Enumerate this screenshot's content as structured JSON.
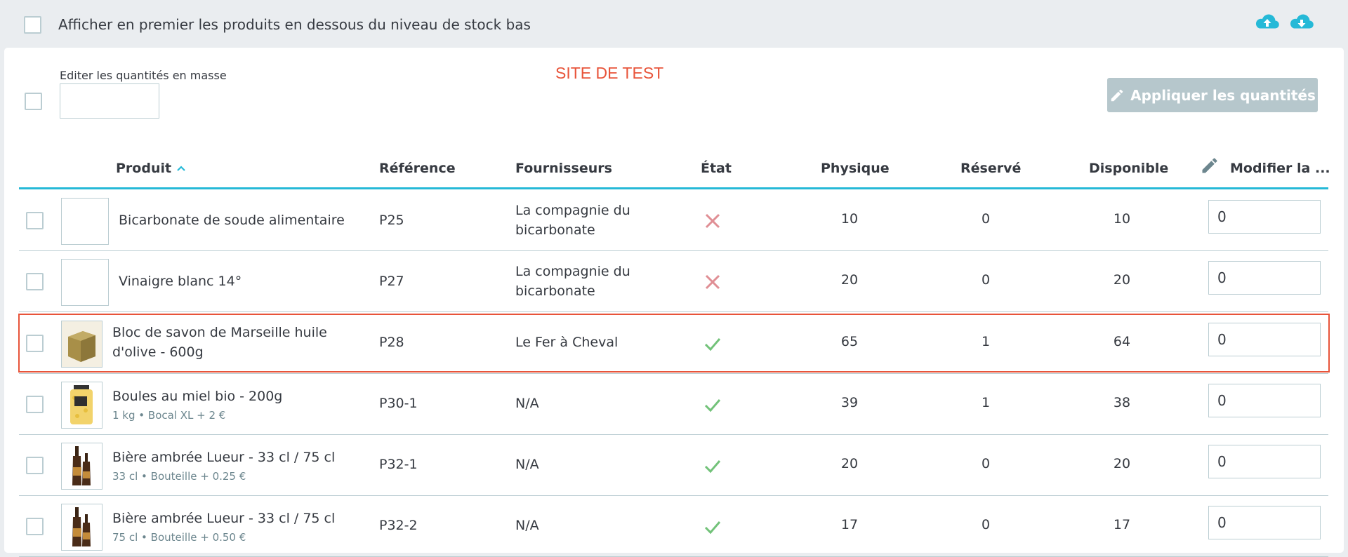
{
  "filter": {
    "label": "Afficher en premier les produits en dessous du niveau de stock bas"
  },
  "watermark": "SITE DE TEST",
  "bulk": {
    "label": "Editer les quantités en masse",
    "value": ""
  },
  "apply_button": {
    "label": "Appliquer les quantités"
  },
  "table": {
    "headers": {
      "product": "Produit",
      "reference": "Référence",
      "suppliers": "Fournisseurs",
      "state": "État",
      "physical": "Physique",
      "reserved": "Réservé",
      "available": "Disponible",
      "edit": "Modifier la ..."
    },
    "rows": [
      {
        "name": "Bicarbonate de soude alimentaire",
        "attr": "",
        "image": "",
        "reference": "P25",
        "supplier": "La compagnie du bicarbonate",
        "state": "inactive",
        "physical": "10",
        "reserved": "0",
        "available": "10",
        "qty": "0"
      },
      {
        "name": "Vinaigre blanc 14°",
        "attr": "",
        "image": "",
        "reference": "P27",
        "supplier": "La compagnie du bicarbonate",
        "state": "inactive",
        "physical": "20",
        "reserved": "0",
        "available": "20",
        "qty": "0"
      },
      {
        "name": "Bloc de savon de Marseille huile d'olive - 600g",
        "attr": "",
        "image": "soap",
        "reference": "P28",
        "supplier": "Le Fer à Cheval",
        "state": "active",
        "physical": "65",
        "reserved": "1",
        "available": "64",
        "qty": "0"
      },
      {
        "name": "Boules au miel bio - 200g",
        "attr": "1 kg • Bocal XL + 2 €",
        "image": "honey",
        "reference": "P30-1",
        "supplier": "N/A",
        "state": "active",
        "physical": "39",
        "reserved": "1",
        "available": "38",
        "qty": "0"
      },
      {
        "name": "Bière ambrée Lueur - 33 cl / 75 cl",
        "attr": "33 cl • Bouteille + 0.25 €",
        "image": "beer",
        "reference": "P32-1",
        "supplier": "N/A",
        "state": "active",
        "physical": "20",
        "reserved": "0",
        "available": "20",
        "qty": "0"
      },
      {
        "name": "Bière ambrée Lueur - 33 cl / 75 cl",
        "attr": "75 cl • Bouteille + 0.50 €",
        "image": "beer",
        "reference": "P32-2",
        "supplier": "N/A",
        "state": "active",
        "physical": "17",
        "reserved": "0",
        "available": "17",
        "qty": "0"
      }
    ]
  },
  "colors": {
    "accent": "#25b9d7",
    "inactive": "#e08f95",
    "active": "#72c279",
    "highlight": "#e8543a"
  }
}
